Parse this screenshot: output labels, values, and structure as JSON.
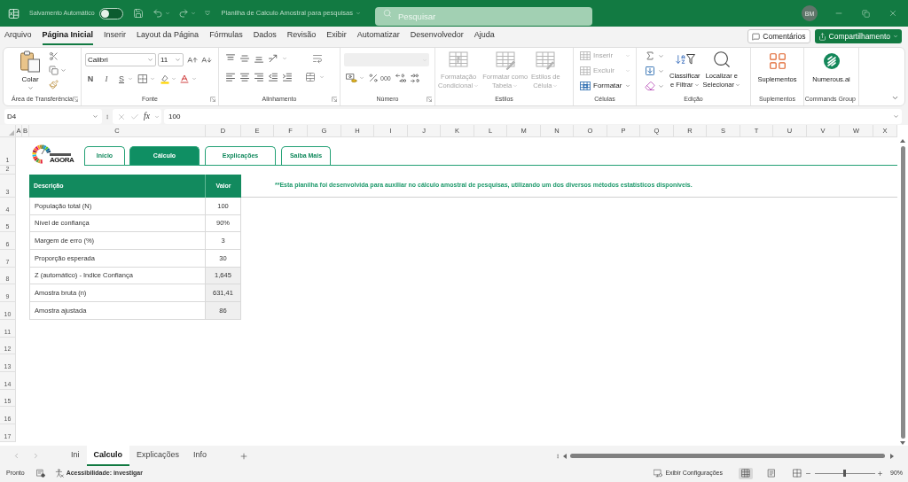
{
  "title_bar": {
    "autosave_label": "Salvamento Automático",
    "autosave_on": false,
    "document_title": "Planilha de Calculo Amostral para pesquisas",
    "search": {
      "placeholder": "Pesquisar"
    },
    "avatar_initials": "BM"
  },
  "menu_tabs": [
    {
      "label": "Arquivo",
      "selected": false
    },
    {
      "label": "Página Inicial",
      "selected": true
    },
    {
      "label": "Inserir",
      "selected": false
    },
    {
      "label": "Layout da Página",
      "selected": false
    },
    {
      "label": "Fórmulas",
      "selected": false
    },
    {
      "label": "Dados",
      "selected": false
    },
    {
      "label": "Revisão",
      "selected": false
    },
    {
      "label": "Exibir",
      "selected": false
    },
    {
      "label": "Automatizar",
      "selected": false
    },
    {
      "label": "Desenvolvedor",
      "selected": false
    },
    {
      "label": "Ajuda",
      "selected": false
    }
  ],
  "header_buttons": {
    "comments": "Comentários",
    "share": "Compartilhamento"
  },
  "ribbon": {
    "clipboard": {
      "label": "Área de Transferência",
      "paste": "Colar"
    },
    "font": {
      "label": "Fonte",
      "font_name": "Calibri",
      "font_size": "11",
      "bold": "N",
      "italic": "I",
      "underline": "S"
    },
    "alignment": {
      "label": "Alinhamento"
    },
    "number": {
      "label": "Número",
      "format_disabled": true,
      "thousands": "000"
    },
    "styles": {
      "label": "Estilos",
      "buttons": [
        {
          "lines": [
            "Formatação",
            "Condicional"
          ],
          "disabled": true
        },
        {
          "lines": [
            "Formatar como",
            "Tabela"
          ],
          "disabled": true
        },
        {
          "lines": [
            "Estilos de",
            "Célula"
          ],
          "disabled": true
        }
      ]
    },
    "cells": {
      "label": "Células",
      "buttons": [
        {
          "label": "Inserir",
          "disabled": true
        },
        {
          "label": "Excluir",
          "disabled": true
        },
        {
          "label": "Formatar",
          "disabled": false
        }
      ]
    },
    "editing": {
      "label": "Edição",
      "buttons": [
        {
          "lines": [
            "Classificar",
            "e Filtrar"
          ]
        },
        {
          "lines": [
            "Localizar e",
            "Selecionar"
          ]
        }
      ]
    },
    "addins": {
      "label": "Suplementos",
      "button": "Suplementos"
    },
    "commands": {
      "label": "Commands Group",
      "button": "Numerous.ai"
    }
  },
  "formula_bar": {
    "name_box": "D4",
    "function_label": "fx",
    "formula": "100"
  },
  "column_headers": [
    "A",
    "B",
    "C",
    "D",
    "E",
    "F",
    "G",
    "H",
    "I",
    "J",
    "K",
    "L",
    "M",
    "N",
    "O",
    "P",
    "Q",
    "R",
    "S",
    "T",
    "U",
    "V",
    "W",
    "X"
  ],
  "row_headers": [
    "1",
    "2",
    "3",
    "4",
    "5",
    "6",
    "7",
    "8",
    "9",
    "10",
    "11",
    "12",
    "13",
    "14",
    "15",
    "16",
    "17"
  ],
  "sheet": {
    "logo_text": "AGORA",
    "nav_tabs": [
      {
        "label": "Início",
        "selected": false
      },
      {
        "label": "Cálculo",
        "selected": true
      },
      {
        "label": "Explicações",
        "selected": false
      },
      {
        "label": "Saiba Mais",
        "selected": false
      }
    ],
    "table": {
      "columns": [
        "Descrição",
        "Valor"
      ],
      "rows": [
        {
          "label": "População total (N)",
          "value": "100",
          "shaded": false
        },
        {
          "label": "Nível de confiança",
          "value": "90%",
          "shaded": false
        },
        {
          "label": "Margem de erro (%)",
          "value": "3",
          "shaded": false
        },
        {
          "label": "Proporção esperada",
          "value": "30",
          "shaded": false
        },
        {
          "label": "Z (automático) - Indice Confiança",
          "value": "1,645",
          "shaded": true
        },
        {
          "label": "Amostra bruta (n)",
          "value": "631,41",
          "shaded": true
        },
        {
          "label": "Amostra ajustada",
          "value": "86",
          "shaded": true
        }
      ]
    },
    "note": "**Esta planilha foi desenvolvida para auxiliar no cálculo amostral de pesquisas, utilizando um dos diversos métodos estatísticos disponíveis."
  },
  "sheet_tabs": [
    {
      "label": "Ini",
      "selected": false
    },
    {
      "label": "Calculo",
      "selected": true
    },
    {
      "label": "Explicações",
      "selected": false
    },
    {
      "label": "Info",
      "selected": false
    }
  ],
  "status_bar": {
    "status": "Pronto",
    "accessibility": "Acessibilidade: investigar",
    "display_settings": "Exibir Configurações",
    "views": [
      {
        "selected": true
      },
      {
        "selected": false
      },
      {
        "selected": false
      }
    ],
    "zoom": {
      "level": 0.49,
      "reading": "90%"
    }
  }
}
